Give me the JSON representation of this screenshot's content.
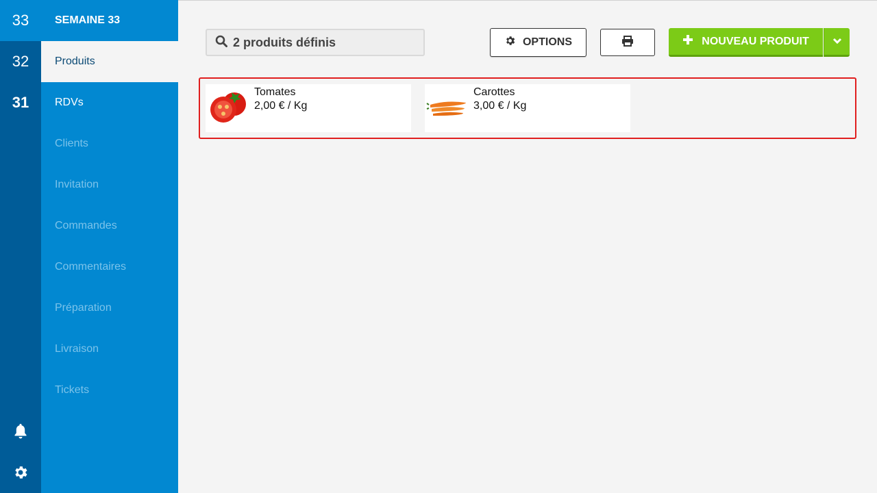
{
  "weeks": [
    {
      "label": "33",
      "active": true
    },
    {
      "label": "32",
      "active": false
    },
    {
      "label": "31",
      "active": false
    }
  ],
  "rail_icons": {
    "notifications": "bell-icon",
    "settings": "gear-icon"
  },
  "nav": {
    "header": "SEMAINE 33",
    "items": [
      {
        "label": "Produits"
      },
      {
        "label": "RDVs"
      },
      {
        "label": "Clients"
      },
      {
        "label": "Invitation"
      },
      {
        "label": "Commandes"
      },
      {
        "label": "Commentaires"
      },
      {
        "label": "Préparation"
      },
      {
        "label": "Livraison"
      },
      {
        "label": "Tickets"
      }
    ]
  },
  "search": {
    "text": "2 produits définis",
    "icon": "search-icon"
  },
  "toolbar": {
    "options_label": "OPTIONS",
    "new_product_label": "NOUVEAU PRODUIT"
  },
  "products": [
    {
      "name": "Tomates",
      "price": "2,00 € / Kg"
    },
    {
      "name": "Carottes",
      "price": "3,00 € / Kg"
    }
  ],
  "colors": {
    "rail": "#005c98",
    "nav": "#0288d1",
    "accent_green": "#7ccb17",
    "highlight_border": "#e01e1e"
  }
}
